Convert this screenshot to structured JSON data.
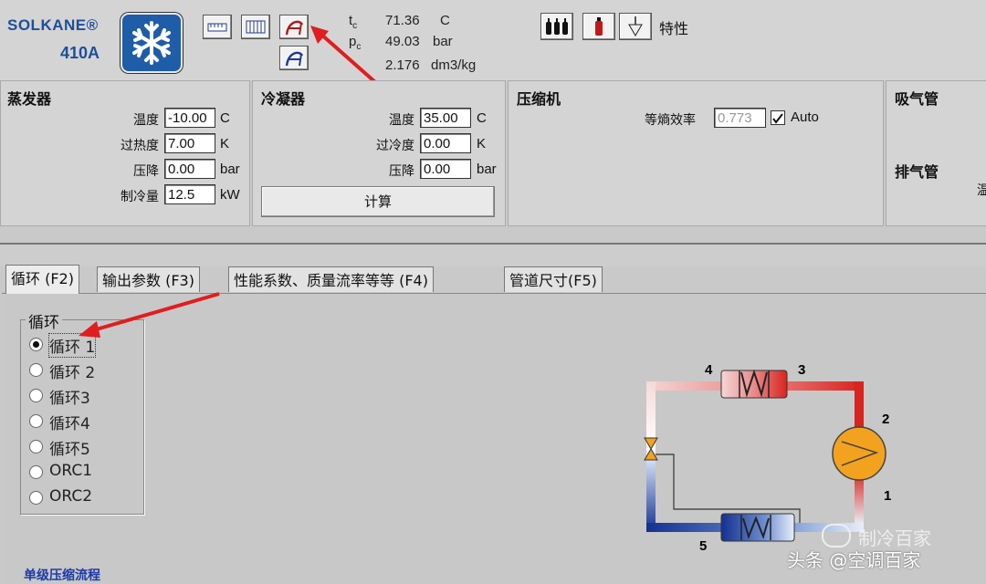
{
  "app": {
    "brand_line1": "SOLKANE®",
    "brand_line2": "410A",
    "logo_icon": "snowflake-icon",
    "characteristic_label": "特性"
  },
  "readout": {
    "tc_label": "t",
    "tc_sub": "c",
    "tc_value": "71.36",
    "tc_unit": "C",
    "pc_label": "p",
    "pc_sub": "c",
    "pc_value": "49.03",
    "pc_unit": "bar",
    "v_value": "2.176",
    "v_unit": "dm3/kg"
  },
  "evaporator": {
    "title": "蒸发器",
    "rows": [
      {
        "label": "温度",
        "value": "-10.00",
        "unit": "C"
      },
      {
        "label": "过热度",
        "value": "7.00",
        "unit": "K"
      },
      {
        "label": "压降",
        "value": "0.00",
        "unit": "bar"
      },
      {
        "label": "制冷量",
        "value": "12.5",
        "unit": "kW"
      }
    ]
  },
  "condenser": {
    "title": "冷凝器",
    "rows": [
      {
        "label": "温度",
        "value": "35.00",
        "unit": "C"
      },
      {
        "label": "过冷度",
        "value": "0.00",
        "unit": "K"
      },
      {
        "label": "压降",
        "value": "0.00",
        "unit": "bar"
      }
    ],
    "calc_button": "计算"
  },
  "compressor": {
    "title": "压缩机",
    "eff_label": "等熵效率",
    "eff_value": "0.773",
    "auto_label": "Auto",
    "auto_checked": true
  },
  "pipes": {
    "suction_title": "吸气管",
    "discharge_title": "排气管",
    "cut_glyph": "温"
  },
  "tabs": [
    {
      "label": "循环 (F2)",
      "active": true
    },
    {
      "label": "输出参数 (F3)",
      "active": false
    },
    {
      "label": "性能系数、质量流率等等 (F4)",
      "active": false
    },
    {
      "label": "管道尺寸(F5)",
      "active": false
    }
  ],
  "cycle_group": {
    "title": "循环",
    "options": [
      "循环 1",
      "循环 2",
      "循环3",
      "循环4",
      "循环5",
      "ORC1",
      "ORC2"
    ],
    "selected_index": 0
  },
  "diagram": {
    "points": [
      "1",
      "2",
      "3",
      "4",
      "5"
    ],
    "colors": {
      "hot": "#d9231c",
      "warm": "#f2a6a6",
      "cold": "#13318f",
      "compressor": "#f3a21f"
    }
  },
  "footer": {
    "caption": "单级压缩流程"
  },
  "watermark": {
    "line1": "制冷百家",
    "line2": "头条 @空调百家"
  }
}
